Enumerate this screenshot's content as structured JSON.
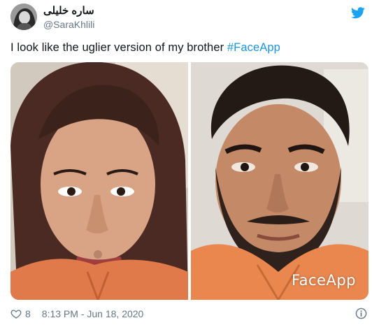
{
  "author": {
    "display_name": "ساره خلیلی",
    "handle": "@SaraKhlili",
    "avatar_icon": "avatar-photo"
  },
  "brand": {
    "icon": "twitter-bird-icon",
    "color": "#1da1f2"
  },
  "tweet": {
    "text": "I look like the uglier version of my brother ",
    "hashtag": "#FaceApp",
    "hashtag_color": "#1b95e0"
  },
  "media": {
    "left_photo": "selfie-photo",
    "right_photo": "faceapp-male-version-photo",
    "watermark": "FaceApp"
  },
  "footer": {
    "like_icon": "heart-icon",
    "like_count": "8",
    "timestamp": "8:13 PM - Jun 18, 2020",
    "info_icon": "info-icon"
  }
}
